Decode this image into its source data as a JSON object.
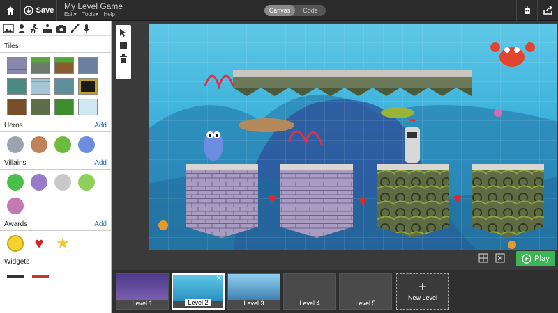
{
  "header": {
    "save_label": "Save",
    "game_title": "My Level Game",
    "menus": [
      "Edit▾",
      "Tools▾",
      "Help"
    ],
    "view_tabs": [
      "Canvas",
      "Code"
    ],
    "active_view": "Canvas"
  },
  "sidebar": {
    "tool_icons": [
      "image-icon",
      "person-icon",
      "running-icon",
      "platform-icon",
      "camera-icon",
      "brush-icon",
      "microphone-icon"
    ],
    "sections": {
      "tiles": {
        "title": "Tiles"
      },
      "heros": {
        "title": "Heros",
        "add": "Add"
      },
      "villains": {
        "title": "Villains",
        "add": "Add"
      },
      "awards": {
        "title": "Awards",
        "add": "Add"
      },
      "widgets": {
        "title": "Widgets"
      }
    }
  },
  "editor": {
    "play_label": "Play"
  },
  "levels": [
    {
      "label": "Level 1"
    },
    {
      "label": "Level 2"
    },
    {
      "label": "Level 3"
    },
    {
      "label": "Level 4"
    },
    {
      "label": "Level 5"
    },
    {
      "label": "New Level"
    }
  ],
  "colors": {
    "accent_blue": "#2a6fb5",
    "play_green": "#3bb556",
    "toolbar_bg": "#2b2b2b"
  }
}
